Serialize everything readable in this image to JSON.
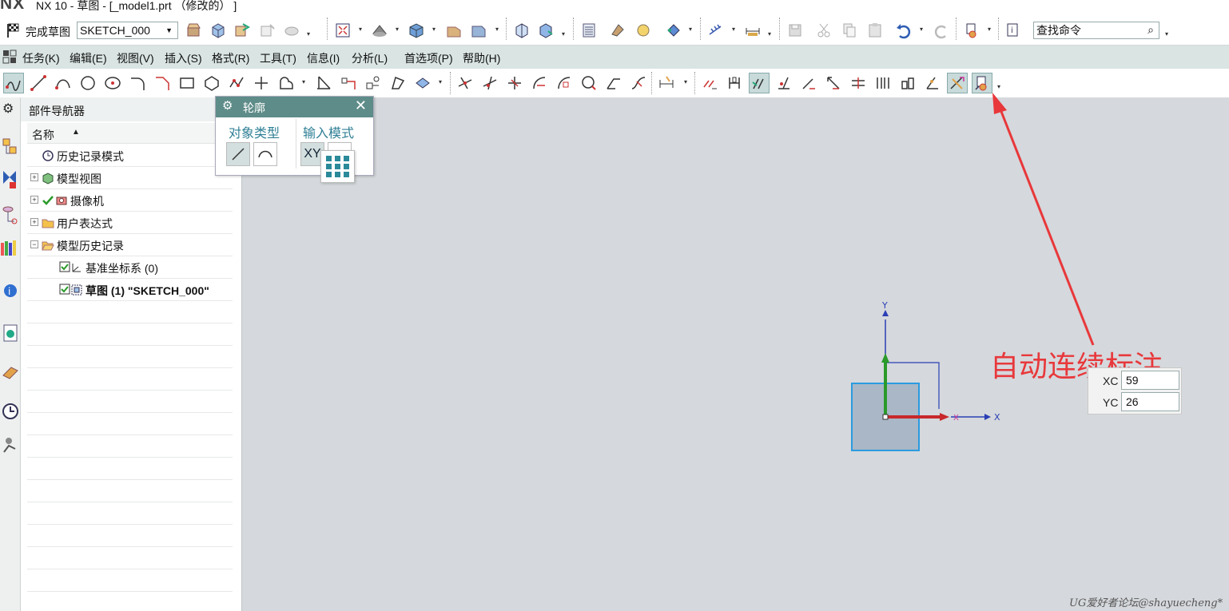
{
  "window": {
    "logo": "NX",
    "title": "NX 10 - 草图 - [_model1.prt （修改的） ]"
  },
  "toolbar": {
    "finish_sketch_label": "完成草图",
    "sketch_name": "SKETCH_000",
    "search_placeholder": "查找命令",
    "icons": [
      "finish-sketch-icon",
      "sketch-name-select",
      "reattach-icon",
      "orient-to-sketch-icon",
      "orient-to-model-icon",
      "update-model-icon",
      "delay-evaluation-icon",
      "fit-view-icon",
      "shaded-icon",
      "box-icon",
      "plane-icon",
      "layer-icon",
      "cube-icon",
      "view-icon",
      "table-icon",
      "measure-icon",
      "check-icon",
      "move-icon",
      "ruler-icon",
      "save-icon",
      "cut-icon",
      "copy-icon",
      "paste-icon",
      "undo-icon",
      "redo-icon",
      "dimension-icon",
      "info-icon",
      "search-icon"
    ]
  },
  "menu": {
    "items": [
      "任务(K)",
      "编辑(E)",
      "视图(V)",
      "插入(S)",
      "格式(R)",
      "工具(T)",
      "信息(I)",
      "分析(L)",
      "首选项(P)",
      "帮助(H)"
    ]
  },
  "sketch_toolbar": {
    "icons": [
      "profile-icon",
      "line-icon",
      "arc-icon",
      "circle-icon",
      "point-icon",
      "fillet-icon",
      "chamfer-icon",
      "rectangle-icon",
      "polygon-icon",
      "studio-spline-icon",
      "add-icon",
      "offset-icon",
      "quick-trim-icon",
      "quick-extend-icon",
      "make-corner-icon",
      "mirror-icon",
      "pattern-icon",
      "project-icon",
      "intersection-icon",
      "derived-lines-icon",
      "rapid-dimension-icon",
      "constraints-icon",
      "geometric-constraints-icon",
      "auto-constrain-icon",
      "show-constraints-icon",
      "convert-reference-icon",
      "alternate-solution-icon",
      "animate-dimension-icon",
      "auto-dimension-icon",
      "continuous-auto-dimension-icon"
    ]
  },
  "navigator": {
    "title": "部件导航器",
    "column_name": "名称",
    "rows": [
      {
        "label": "历史记录模式",
        "bold": false
      },
      {
        "label": "模型视图",
        "bold": false
      },
      {
        "label": "摄像机",
        "bold": false
      },
      {
        "label": "用户表达式",
        "bold": false
      },
      {
        "label": "模型历史记录",
        "bold": false
      },
      {
        "label": "基准坐标系 (0)",
        "bold": false
      },
      {
        "label": "草图 (1) \"SKETCH_000\"",
        "bold": true
      }
    ]
  },
  "profile_dialog": {
    "title": "轮廓",
    "object_type_label": "对象类型",
    "input_mode_label": "输入模式",
    "xy_label": "XY"
  },
  "coord_input": {
    "xc_label": "XC",
    "xc_value": "59",
    "yc_label": "YC",
    "yc_value": "26"
  },
  "canvas": {
    "axis_y_label": "Y",
    "axis_x_label": "X"
  },
  "annotation": {
    "text": "自动连续标注",
    "color": "#e8383b"
  },
  "watermark": "UG爱好者论坛@shayuecheng*",
  "colors": {
    "menubar_bg": "#d9e4e3",
    "dialog_head": "#5e8c89",
    "group_label": "#2f7f96",
    "canvas_bg": "#d5d8dc"
  }
}
